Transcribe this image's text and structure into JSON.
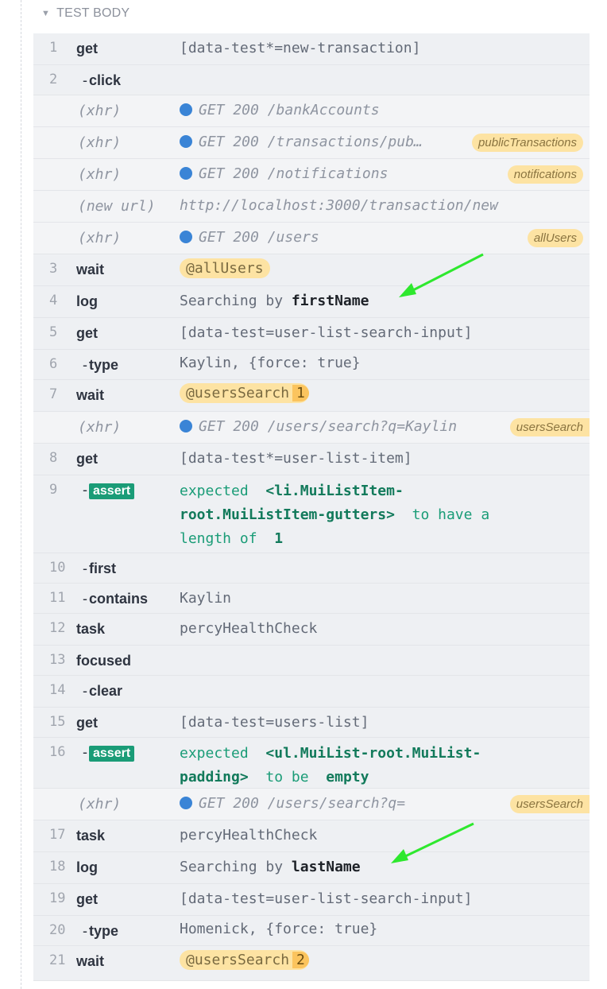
{
  "header": {
    "label": "TEST BODY"
  },
  "rows": {
    "r1": {
      "num": "1",
      "name": "get",
      "msg": "[data-test*=new-transaction]"
    },
    "r2": {
      "num": "2",
      "name": "click"
    },
    "x1": {
      "name": "(xhr)",
      "msg": "GET 200 /bankAccounts"
    },
    "x2": {
      "name": "(xhr)",
      "msg": "GET 200 /transactions/pub…",
      "tag": "publicTransactions"
    },
    "x3": {
      "name": "(xhr)",
      "msg": "GET 200 /notifications",
      "tag": "notifications"
    },
    "x4": {
      "name": "(new url)",
      "msg": "http://localhost:3000/transaction/new"
    },
    "x5": {
      "name": "(xhr)",
      "msg": "GET 200 /users",
      "tag": "allUsers"
    },
    "r3": {
      "num": "3",
      "name": "wait",
      "alias": "@allUsers"
    },
    "r4": {
      "num": "4",
      "name": "log",
      "msg_prefix": "Searching by ",
      "msg_bold": "firstName"
    },
    "r5": {
      "num": "5",
      "name": "get",
      "msg": "[data-test=user-list-search-input]"
    },
    "r6": {
      "num": "6",
      "name": "type",
      "msg": "Kaylin, {force: true}"
    },
    "r7": {
      "num": "7",
      "name": "wait",
      "alias": "@usersSearch",
      "count": "1"
    },
    "x6": {
      "name": "(xhr)",
      "msg": "GET 200 /users/search?q=Kaylin",
      "tag": "usersSearch"
    },
    "r8": {
      "num": "8",
      "name": "get",
      "msg": "[data-test*=user-list-item]"
    },
    "r9": {
      "num": "9",
      "badge": "assert",
      "expected": "expected",
      "subject": "<li.MuiListItem-root.MuiListItem-gutters>",
      "middle": "to have a length of",
      "value": "1"
    },
    "r10": {
      "num": "10",
      "name": "first"
    },
    "r11": {
      "num": "11",
      "name": "contains",
      "msg": "Kaylin"
    },
    "r12": {
      "num": "12",
      "name": "task",
      "msg": "percyHealthCheck"
    },
    "r13": {
      "num": "13",
      "name": "focused"
    },
    "r14": {
      "num": "14",
      "name": "clear"
    },
    "r15": {
      "num": "15",
      "name": "get",
      "msg": "[data-test=users-list]"
    },
    "r16": {
      "num": "16",
      "badge": "assert",
      "expected": "expected",
      "subject": "<ul.MuiList-root.MuiList-padding>",
      "middle": "to be",
      "value": "empty"
    },
    "x7": {
      "name": "(xhr)",
      "msg": "GET 200 /users/search?q=",
      "tag": "usersSearch"
    },
    "r17": {
      "num": "17",
      "name": "task",
      "msg": "percyHealthCheck"
    },
    "r18": {
      "num": "18",
      "name": "log",
      "msg_prefix": "Searching by ",
      "msg_bold": "lastName"
    },
    "r19": {
      "num": "19",
      "name": "get",
      "msg": "[data-test=user-list-search-input]"
    },
    "r20": {
      "num": "20",
      "name": "type",
      "msg": "Homenick, {force: true}"
    },
    "r21": {
      "num": "21",
      "name": "wait",
      "alias": "@usersSearch",
      "count": "2"
    }
  },
  "colors": {
    "xhr_dot": "#3a84d6",
    "alias_bg": "#fde3a3",
    "assert_green": "#1a9c77",
    "arrow": "#2ee82e"
  }
}
